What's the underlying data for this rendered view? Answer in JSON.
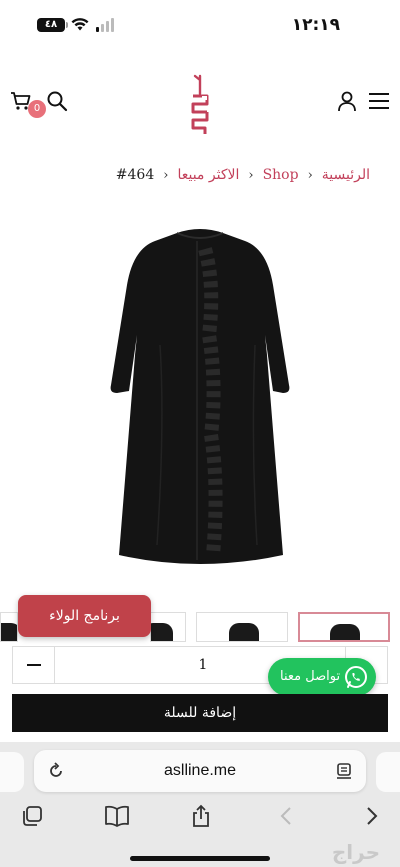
{
  "status_bar": {
    "time": "١٢:١٩",
    "battery": "٤٨"
  },
  "header": {
    "cart_count": "0"
  },
  "breadcrumb": {
    "home": "الرئيسية",
    "shop": "Shop",
    "category": "الاكثر مبيعا",
    "current": "#464",
    "separator": "›"
  },
  "product": {
    "quantity": "1"
  },
  "buttons": {
    "loyalty": "برنامج الولاء",
    "whatsapp": "تواصل معنا",
    "add_to_cart": "إضافة للسلة"
  },
  "browser": {
    "url": "aslline.me"
  },
  "watermark": "حراج",
  "colors": {
    "accent": "#c2405a",
    "loyalty": "#c0424a",
    "whatsapp": "#22c35e",
    "badge": "#e8707a"
  }
}
